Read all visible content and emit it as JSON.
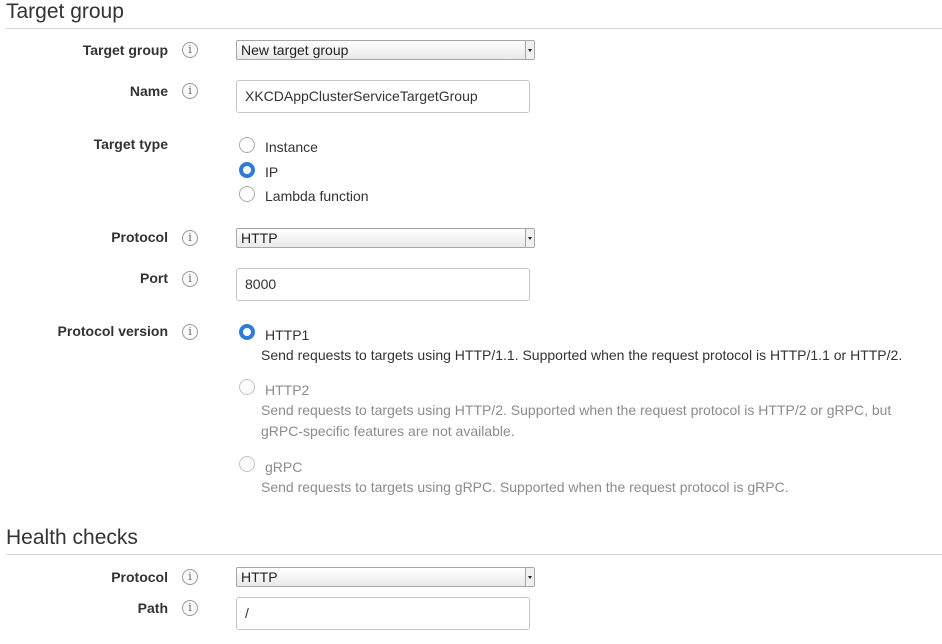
{
  "target_group_section": {
    "title": "Target group",
    "target_group": {
      "label": "Target group",
      "selected": "New target group"
    },
    "name": {
      "label": "Name",
      "value": "XKCDAppClusterServiceTargetGroup"
    },
    "target_type": {
      "label": "Target type",
      "options": [
        {
          "label": "Instance",
          "checked": false
        },
        {
          "label": "IP",
          "checked": true
        },
        {
          "label": "Lambda function",
          "checked": false
        }
      ]
    },
    "protocol": {
      "label": "Protocol",
      "selected": "HTTP"
    },
    "port": {
      "label": "Port",
      "value": "8000"
    },
    "protocol_version": {
      "label": "Protocol version",
      "options": [
        {
          "label": "HTTP1",
          "checked": true,
          "disabled": false,
          "description": "Send requests to targets using HTTP/1.1. Supported when the request protocol is HTTP/1.1 or HTTP/2."
        },
        {
          "label": "HTTP2",
          "checked": false,
          "disabled": true,
          "description_line1": "Send requests to targets using HTTP/2. Supported when the request protocol is HTTP/2 or gRPC, but",
          "description_line2": "gRPC-specific features are not available."
        },
        {
          "label": "gRPC",
          "checked": false,
          "disabled": true,
          "description": "Send requests to targets using gRPC. Supported when the request protocol is gRPC."
        }
      ]
    }
  },
  "health_checks_section": {
    "title": "Health checks",
    "protocol": {
      "label": "Protocol",
      "selected": "HTTP"
    },
    "path": {
      "label": "Path",
      "value": "/"
    }
  },
  "icons": {
    "info": "info-icon",
    "info_glyph": "i"
  },
  "colors": {
    "radio_checked": "#2f7cd8",
    "divider": "#d5d5d5",
    "disabled_text": "#8c8c8c"
  }
}
